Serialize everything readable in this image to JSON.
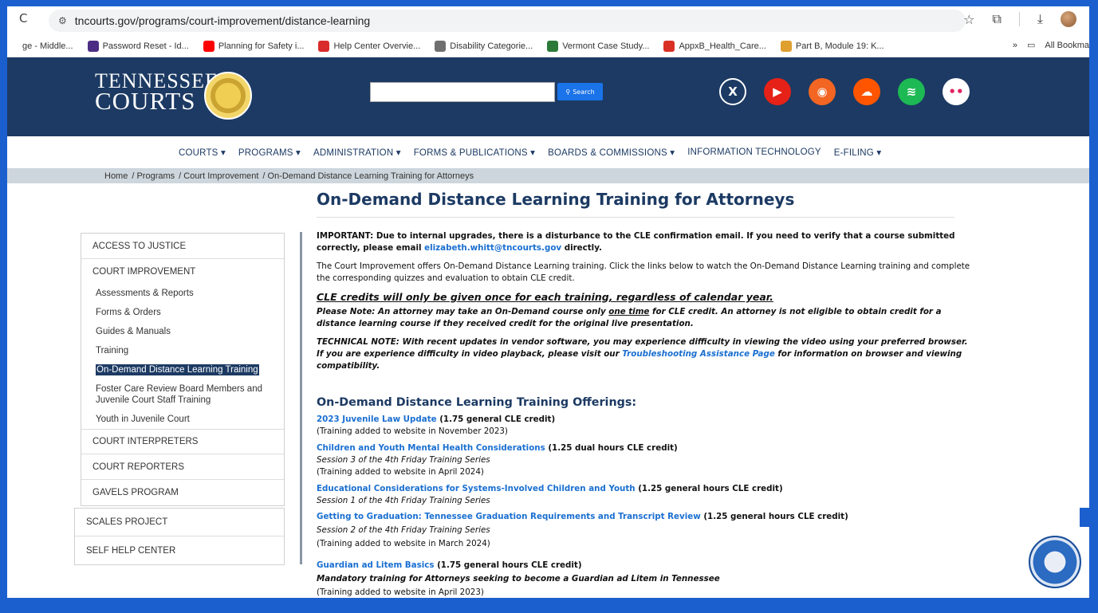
{
  "browser": {
    "url": "tncourts.gov/programs/court-improvement/distance-learning",
    "bookmarks": [
      {
        "label": "ge - Middle...",
        "color": "#ffffff"
      },
      {
        "label": "Password Reset - Id...",
        "color": "#4b2e83"
      },
      {
        "label": "Planning for Safety i...",
        "color": "#ff0000"
      },
      {
        "label": "Help Center Overvie...",
        "color": "#d92b2b"
      },
      {
        "label": "Disability Categorie...",
        "color": "#6f6f6f"
      },
      {
        "label": "Vermont Case Study...",
        "color": "#2b7a3a"
      },
      {
        "label": "AppxB_Health_Care...",
        "color": "#d93025"
      },
      {
        "label": "Part B, Module 19: K...",
        "color": "#e0a030"
      }
    ],
    "all_bookmarks": "All Bookma",
    "more": "»"
  },
  "site": {
    "logo_line1": "TENNESSEE",
    "logo_line2": "COURTS",
    "search_label": "Search",
    "social": [
      {
        "icon": "x-icon",
        "color": "#1c3a63",
        "glyph": "X"
      },
      {
        "icon": "youtube-icon",
        "color": "#e62117",
        "glyph": "▶"
      },
      {
        "icon": "rss-icon",
        "color": "#f26522",
        "glyph": "◉"
      },
      {
        "icon": "soundcloud-icon",
        "color": "#ff5500",
        "glyph": "☁"
      },
      {
        "icon": "spotify-icon",
        "color": "#1db954",
        "glyph": "≋"
      },
      {
        "icon": "flickr-icon",
        "color": "#ffffff",
        "glyph": "••"
      }
    ]
  },
  "nav": [
    "COURTS ▾",
    "PROGRAMS ▾",
    "ADMINISTRATION ▾",
    "FORMS & PUBLICATIONS ▾",
    "BOARDS & COMMISSIONS ▾",
    "INFORMATION TECHNOLOGY",
    "E-FILING ▾"
  ],
  "breadcrumb": [
    "Home",
    "/ Programs",
    "/ Court Improvement",
    "/ On-Demand Distance Learning Training for Attorneys"
  ],
  "sidebar": {
    "access_to_justice": "ACCESS TO JUSTICE",
    "court_improvement": "COURT IMPROVEMENT",
    "items": [
      "Assessments & Reports",
      "Forms & Orders",
      "Guides & Manuals",
      "Training",
      "On-Demand Distance Learning Training",
      "Foster Care Review Board Members and Juvenile Court Staff Training",
      "Youth in Juvenile Court"
    ],
    "court_interpreters": "COURT INTERPRETERS",
    "court_reporters": "COURT REPORTERS",
    "gavels_program": "GAVELS PROGRAM",
    "scales_project": "SCALES PROJECT",
    "self_help_center": "SELF HELP CENTER"
  },
  "main": {
    "title": "On-Demand Distance Learning Training for Attorneys",
    "important_1": "IMPORTANT: Due to internal upgrades, there is a disturbance to the CLE confirmation email. If you need to verify that a course submitted correctly, please email ",
    "important_email": "elizabeth.whitt@tncourts.gov",
    "important_2": " directly.",
    "intro": "The Court Improvement offers On-Demand Distance Learning training.  Click the links below to watch the On-Demand Distance Learning training and complete the corresponding quizzes and evaluation to obtain CLE credit.",
    "cle_heading": "CLE credits will only be given once for each training, regardless of calendar year.",
    "note_1": "Please Note:  An attorney may take an On-Demand course only ",
    "note_onetime": "one time",
    "note_2": " for CLE credit. An attorney is not eligible to obtain credit for a distance learning course if they received credit for the original live presentation.",
    "tech_1": "TECHNICAL NOTE:  With recent updates in vendor software, you may experience difficulty in viewing the video using your  preferred browser.  If you are experience difficulty in video playback, please visit our ",
    "tech_link": "Troubleshooting Assistance Page",
    "tech_2": " for information on browser and viewing compatibility.",
    "offerings_heading": "On-Demand Distance Learning Training Offerings:",
    "offerings": [
      {
        "title": "2023 Juvenile Law Update",
        "credit": " (1.75 general CLE credit)",
        "series": "",
        "added": "(Training added to website in November 2023)"
      },
      {
        "title": "Children and Youth Mental Health Considerations",
        "credit": " (1.25 dual hours CLE credit)",
        "series": "Session 3 of the 4th Friday Training Series",
        "added": "(Training added to website in April 2024)"
      },
      {
        "title": "Educational Considerations for Systems-Involved Children and Youth",
        "credit": " (1.25 general hours CLE credit)",
        "series": "Session 1 of the 4th Friday Training Series",
        "added": ""
      }
    ],
    "overlay_offerings": [
      {
        "title": "Getting to Graduation: Tennessee Graduation Requirements and Transcript Review",
        "credit": " (1.25 general hours CLE credit)",
        "series": "Session 2 of the 4th Friday Training Series",
        "added": "(Training added to website in March 2024)"
      },
      {
        "title": "Guardian ad Litem Basics",
        "credit": " (1.75 general hours CLE credit)",
        "series": "Mandatory training for Attorneys seeking to become a Guardian ad Litem in Tennessee",
        "added": "(Training added to website in April 2023)"
      }
    ]
  }
}
